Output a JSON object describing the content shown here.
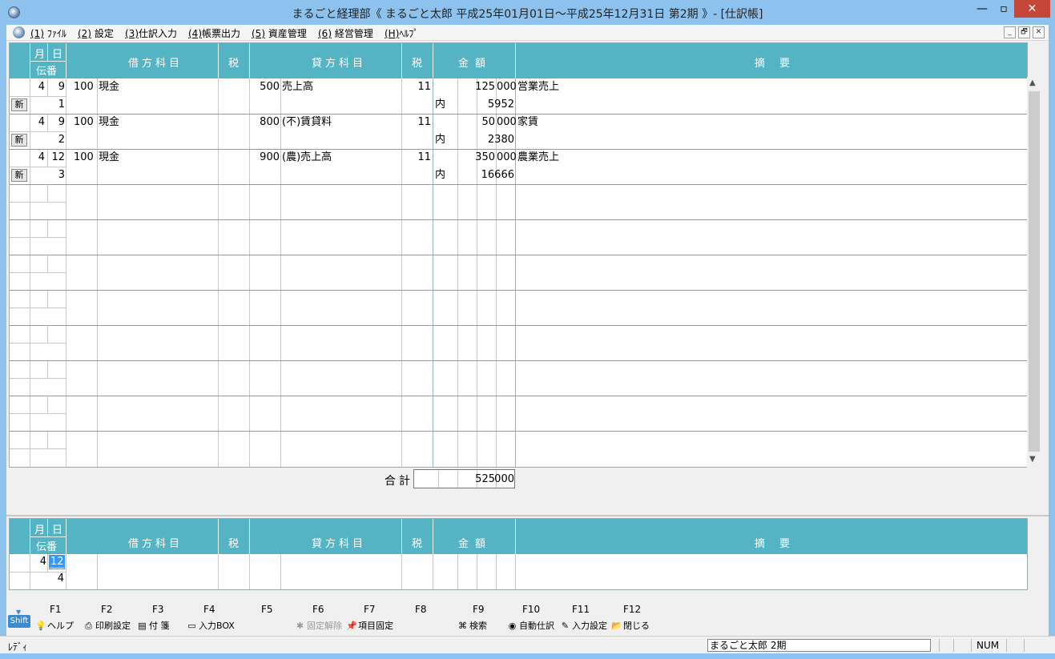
{
  "window": {
    "title": "まるごと経理部《 まるごと太郎  平成25年01月01日～平成25年12月31日 第2期 》- [仕訳帳]",
    "min": "—",
    "max": "▫",
    "close": "✕"
  },
  "menu": [
    {
      "key": "(1)",
      "label": "ﾌｧｲﾙ"
    },
    {
      "key": "(2)",
      "label": "設定"
    },
    {
      "key": "(3)",
      "label": "仕訳入力"
    },
    {
      "key": "(4)",
      "label": "帳票出力"
    },
    {
      "key": "(5)",
      "label": "資産管理"
    },
    {
      "key": "(6)",
      "label": "経営管理"
    },
    {
      "key": "(H)",
      "label": "ﾍﾙﾌﾟ"
    }
  ],
  "mdi": {
    "min": "_",
    "restore": "🗗",
    "close": "✕"
  },
  "header": {
    "month": "月",
    "day": "日",
    "voucher": "伝番",
    "debit": "借方科目",
    "tax1": "税",
    "credit": "貸方科目",
    "tax2": "税",
    "amount": "金額",
    "memo": "摘要"
  },
  "entries": [
    {
      "month": "4",
      "day": "9",
      "voucher": "1",
      "debit_code": "100",
      "debit_name": "現金",
      "credit_code": "500",
      "credit_name": "売上高",
      "tax": "11",
      "inner": "内",
      "amount_hi": "125",
      "amount_lo": "000",
      "tax_amount": "5952",
      "memo": "営業売上",
      "new_label": "新"
    },
    {
      "month": "4",
      "day": "9",
      "voucher": "2",
      "debit_code": "100",
      "debit_name": "現金",
      "credit_code": "800",
      "credit_name": "(不)賃貸料",
      "tax": "11",
      "inner": "内",
      "amount_hi": "50",
      "amount_lo": "000",
      "tax_amount": "2380",
      "memo": "家賃",
      "new_label": "新"
    },
    {
      "month": "4",
      "day": "12",
      "voucher": "3",
      "debit_code": "100",
      "debit_name": "現金",
      "credit_code": "900",
      "credit_name": "(農)売上高",
      "tax": "11",
      "inner": "内",
      "amount_hi": "350",
      "amount_lo": "000",
      "tax_amount": "16666",
      "memo": "農業売上",
      "new_label": "新"
    }
  ],
  "total": {
    "label": "合計",
    "hi": "525",
    "lo": "000"
  },
  "input": {
    "month": "4",
    "day": "12",
    "voucher": "4"
  },
  "fkeys": [
    {
      "key": "F1",
      "label": "ヘルプ",
      "icon": "lightbulb-icon"
    },
    {
      "key": "F2",
      "label": "印刷設定",
      "icon": "printer-icon"
    },
    {
      "key": "F3",
      "label": "付 箋",
      "icon": "sticky-note-icon"
    },
    {
      "key": "F4",
      "label": "入力BOX",
      "icon": "inputbox-icon"
    },
    {
      "key": "F5",
      "label": "",
      "icon": ""
    },
    {
      "key": "F6",
      "label": "固定解除",
      "icon": "unpin-icon"
    },
    {
      "key": "F7",
      "label": "項目固定",
      "icon": "pin-icon"
    },
    {
      "key": "F8",
      "label": "",
      "icon": ""
    },
    {
      "key": "F9",
      "label": "検索",
      "icon": "binoculars-icon"
    },
    {
      "key": "F10",
      "label": "自動仕訳",
      "icon": "auto-journal-icon"
    },
    {
      "key": "F11",
      "label": "入力設定",
      "icon": "input-settings-icon"
    },
    {
      "key": "F12",
      "label": "閉じる",
      "icon": "folder-close-icon"
    }
  ],
  "shift": "Shift",
  "status": {
    "left": "ﾚﾃﾞｨ",
    "user": "まるごと太郎  2期",
    "num": "NUM"
  },
  "colors": {
    "header_bg": "#54b4c4",
    "title_bg": "#8ec2ee",
    "close_btn": "#c7463a"
  }
}
